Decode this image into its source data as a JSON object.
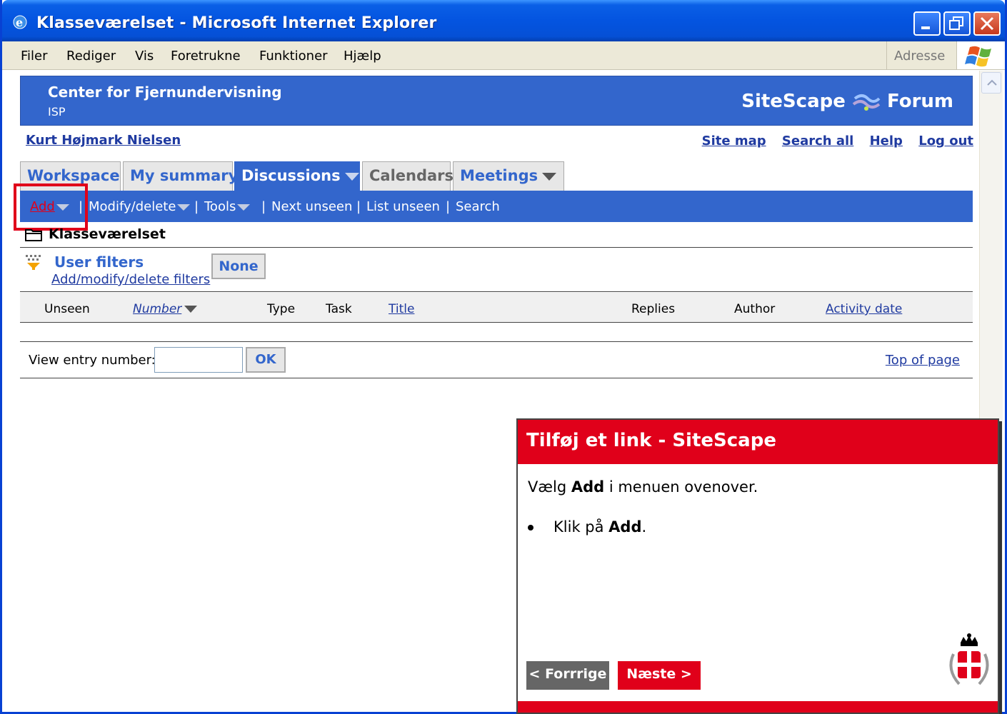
{
  "window": {
    "title": "Klasseværelset - Microsoft Internet Explorer"
  },
  "menubar": {
    "items": [
      "Filer",
      "Rediger",
      "Vis",
      "Foretrukne",
      "Funktioner",
      "Hjælp"
    ],
    "address_label": "Adresse"
  },
  "banner": {
    "org": "Center for Fjernundervisning",
    "sub": "ISP",
    "brand_left": "SiteScape",
    "brand_right": "Forum"
  },
  "user_name": "Kurt Højmark Nielsen",
  "toplinks": [
    "Site map",
    "Search all",
    "Help",
    "Log out"
  ],
  "tabs": [
    "Workspace",
    "My summary",
    "Discussions",
    "Calendars",
    "Meetings"
  ],
  "toolbar": {
    "add": "Add",
    "modify": "Modify/delete",
    "tools": "Tools",
    "next_unseen": "Next unseen",
    "list_unseen": "List unseen",
    "search": "Search",
    "separator": "|"
  },
  "folder": "Klasseværelset",
  "filters": {
    "title": "User filters",
    "link": "Add/modify/delete filters",
    "current": "None"
  },
  "table": {
    "headers": [
      "Unseen",
      "Number",
      "Type",
      "Task",
      "Title",
      "Replies",
      "Author",
      "Activity date"
    ]
  },
  "view_entry": {
    "label": "View entry number:",
    "value": "",
    "ok": "OK",
    "top_link": "Top of page"
  },
  "tutorial": {
    "title": "Tilføj et link - SiteScape",
    "intro_pre": "Vælg ",
    "intro_bold": "Add",
    "intro_post": " i menuen ovenover.",
    "step_pre": "Klik på ",
    "step_bold": "Add",
    "step_post": ".",
    "prev": "< Forrrige",
    "next": "Næste >"
  },
  "colors": {
    "accent_blue": "#3366cc",
    "tutorial_red": "#e0001a"
  }
}
